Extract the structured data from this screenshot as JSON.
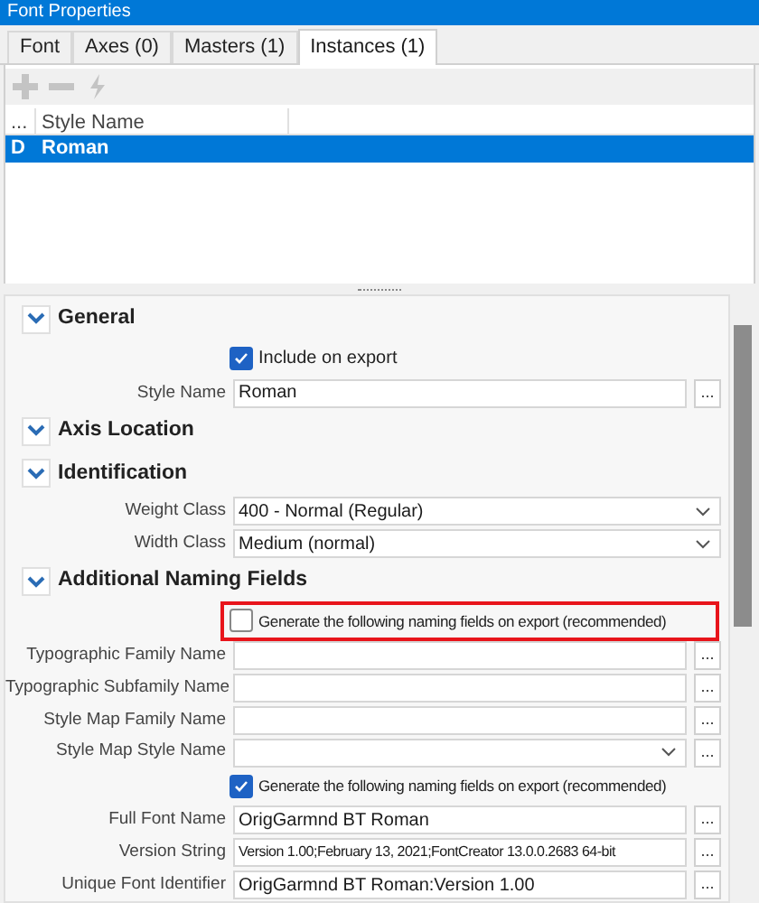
{
  "window": {
    "title": "Font Properties"
  },
  "tabs": [
    {
      "label": "Font",
      "selected": false
    },
    {
      "label": "Axes (0)",
      "selected": false
    },
    {
      "label": "Masters (1)",
      "selected": false
    },
    {
      "label": "Instances (1)",
      "selected": true
    }
  ],
  "toolbar": [
    {
      "kind": "add",
      "disabled": true
    },
    {
      "kind": "remove",
      "disabled": true
    },
    {
      "kind": "generate",
      "disabled": true
    }
  ],
  "table": {
    "columns": [
      "...",
      "Style Name"
    ],
    "rows": [
      {
        "marker": "D",
        "style_name": "Roman",
        "selected": true
      }
    ]
  },
  "properties": [
    {
      "kind": "header",
      "label": "General",
      "expanded": true
    },
    {
      "kind": "checkbox",
      "label": "Include on export",
      "checked": true,
      "highlighted": false
    },
    {
      "kind": "field",
      "label": "Style Name",
      "value": "Roman",
      "button": "..."
    },
    {
      "kind": "header",
      "label": "Axis Location",
      "expanded": true
    },
    {
      "kind": "header",
      "label": "Identification",
      "expanded": true
    },
    {
      "kind": "dropdown",
      "label": "Weight Class",
      "value": "400 - Normal (Regular)"
    },
    {
      "kind": "dropdown",
      "label": "Width Class",
      "value": "Medium (normal)"
    },
    {
      "kind": "header",
      "label": "Additional Naming Fields",
      "expanded": true
    },
    {
      "kind": "checkbox",
      "label": "Generate the following naming fields on export (recommended)",
      "checked": false,
      "highlighted": true
    },
    {
      "kind": "field",
      "label": "Typographic Family Name",
      "button": "..."
    },
    {
      "kind": "field",
      "label": "Typographic Subfamily Name",
      "button": "..."
    },
    {
      "kind": "field",
      "label": "Style Map Family Name",
      "button": "..."
    },
    {
      "kind": "dropdown",
      "label": "Style Map Style Name",
      "button": "..."
    },
    {
      "kind": "checkbox",
      "label": "Generate the following naming fields on export (recommended)",
      "checked": true,
      "highlighted": false
    },
    {
      "kind": "field",
      "label": "Full Font Name",
      "value": "OrigGarmnd BT Roman",
      "button": "..."
    },
    {
      "kind": "field",
      "label": "Version String",
      "value": "Version 1.00;February 13, 2021;FontCreator 13.0.0.2683 64-bit",
      "button": "..."
    },
    {
      "kind": "field",
      "label": "Unique Font Identifier",
      "value": "OrigGarmnd BT Roman:Version 1.00",
      "button": "..."
    }
  ]
}
